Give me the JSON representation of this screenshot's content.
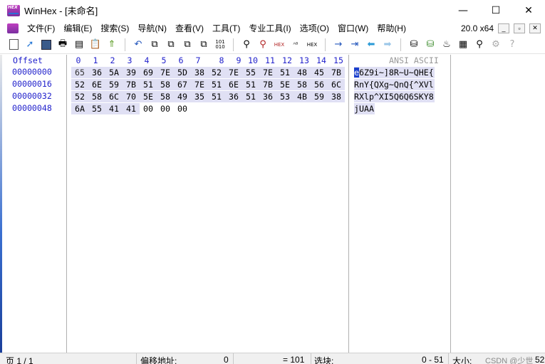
{
  "window": {
    "title": "WinHex - [未命名]",
    "minimize": "—",
    "maximize": "☐",
    "close": "✕"
  },
  "menu": {
    "items": [
      "文件(F)",
      "编辑(E)",
      "搜索(S)",
      "导航(N)",
      "查看(V)",
      "工具(T)",
      "专业工具(I)",
      "选项(O)",
      "窗口(W)",
      "帮助(H)"
    ],
    "version": "20.0 x64"
  },
  "toolbar": {
    "icons": [
      "new-file-icon",
      "open-icon",
      "save-icon",
      "print-icon",
      "properties-icon",
      "clipboard-icon",
      "export-icon",
      "undo-icon",
      "copy-icon",
      "copy-block-icon",
      "paste-icon",
      "paste-block-icon",
      "binary-icon",
      "find-icon",
      "find-hex-icon",
      "replace-icon",
      "replace-hex-icon",
      "goto-offset-icon",
      "jump-to-icon",
      "back-icon",
      "forward-icon",
      "open-disk-icon",
      "add-disk-icon",
      "ram-icon",
      "calculator-icon",
      "magnifier-icon",
      "info-icon",
      "help-icon"
    ]
  },
  "editor": {
    "offset_header": "Offset",
    "column_headers": [
      "0",
      "1",
      "2",
      "3",
      "4",
      "5",
      "6",
      "7",
      "8",
      "9",
      "10",
      "11",
      "12",
      "13",
      "14",
      "15"
    ],
    "ascii_header": "ANSI ASCII",
    "rows": [
      {
        "offset": "00000000",
        "bytes": [
          "65",
          "36",
          "5A",
          "39",
          "69",
          "7E",
          "5D",
          "38",
          "52",
          "7E",
          "55",
          "7E",
          "51",
          "48",
          "45",
          "7B"
        ],
        "ascii_cursor": "e",
        "ascii_rest": "6Z9i~]8R~U~QHE{"
      },
      {
        "offset": "00000016",
        "bytes": [
          "52",
          "6E",
          "59",
          "7B",
          "51",
          "58",
          "67",
          "7E",
          "51",
          "6E",
          "51",
          "7B",
          "5E",
          "58",
          "56",
          "6C"
        ],
        "ascii_cursor": "",
        "ascii_rest": "RnY{QXg~QnQ{^XVl"
      },
      {
        "offset": "00000032",
        "bytes": [
          "52",
          "58",
          "6C",
          "70",
          "5E",
          "58",
          "49",
          "35",
          "51",
          "36",
          "51",
          "36",
          "53",
          "4B",
          "59",
          "38"
        ],
        "ascii_cursor": "",
        "ascii_rest": "RXlp^XI5Q6Q6SKY8"
      },
      {
        "offset": "00000048",
        "bytes": [
          "6A",
          "55",
          "41",
          "41",
          "00",
          "00",
          "00"
        ],
        "ascii_cursor": "",
        "ascii_rest": "jUAA"
      }
    ]
  },
  "status": {
    "page": "页 1 / 1",
    "offset_label": "偏移地址:",
    "offset_value": "0",
    "value": "= 101",
    "selection_label": "选块:",
    "selection_value": "0 - 51",
    "size_label": "大小:",
    "size_value": "52",
    "watermark": "CSDN @少世"
  }
}
